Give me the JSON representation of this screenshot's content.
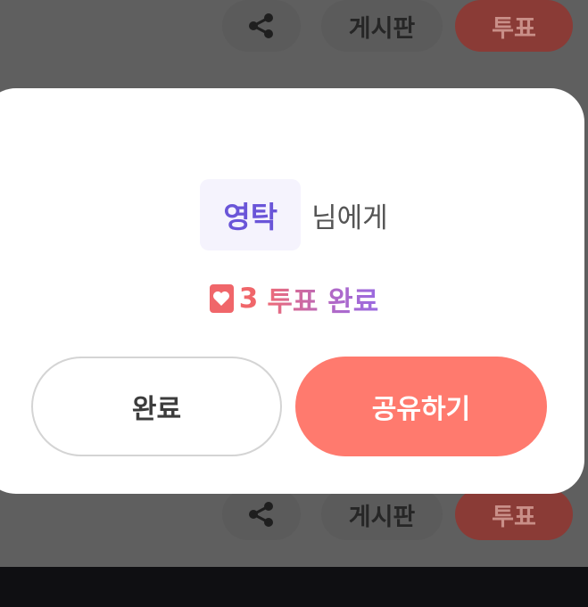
{
  "background": {
    "top_row": {
      "board_label": "게시판",
      "vote_label": "투표"
    },
    "bottom_row": {
      "board_label": "게시판",
      "vote_label": "투표"
    }
  },
  "modal": {
    "recipient_name": "영탁",
    "recipient_suffix": "님에게",
    "vote_count": "3",
    "vote_status": "투표 완료",
    "buttons": {
      "done_label": "완료",
      "share_label": "공유하기"
    }
  },
  "colors": {
    "accent": "#ff7a6e",
    "name_purple": "#6a55d8",
    "heart_red": "#f0666a"
  },
  "icons": [
    "share-icon",
    "heart-icon"
  ]
}
